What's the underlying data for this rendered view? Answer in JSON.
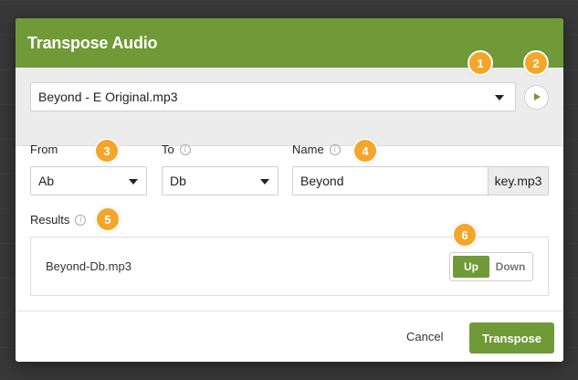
{
  "dialog": {
    "title": "Transpose Audio"
  },
  "file": {
    "selected": "Beyond - E Original.mp3",
    "play_icon": "play-icon"
  },
  "from": {
    "label": "From",
    "value": "Ab"
  },
  "to": {
    "label": "To",
    "value": "Db"
  },
  "name": {
    "label": "Name",
    "value": "Beyond",
    "suffix": "key.mp3"
  },
  "results": {
    "label": "Results",
    "filename": "Beyond-Db.mp3",
    "toggle": {
      "up_label": "Up",
      "down_label": "Down",
      "selected": "Up"
    }
  },
  "footer": {
    "cancel_label": "Cancel",
    "transpose_label": "Transpose"
  },
  "badges": [
    "1",
    "2",
    "3",
    "4",
    "5",
    "6"
  ],
  "colors": {
    "accent": "#6f9a37",
    "badge": "#f4a62a"
  }
}
